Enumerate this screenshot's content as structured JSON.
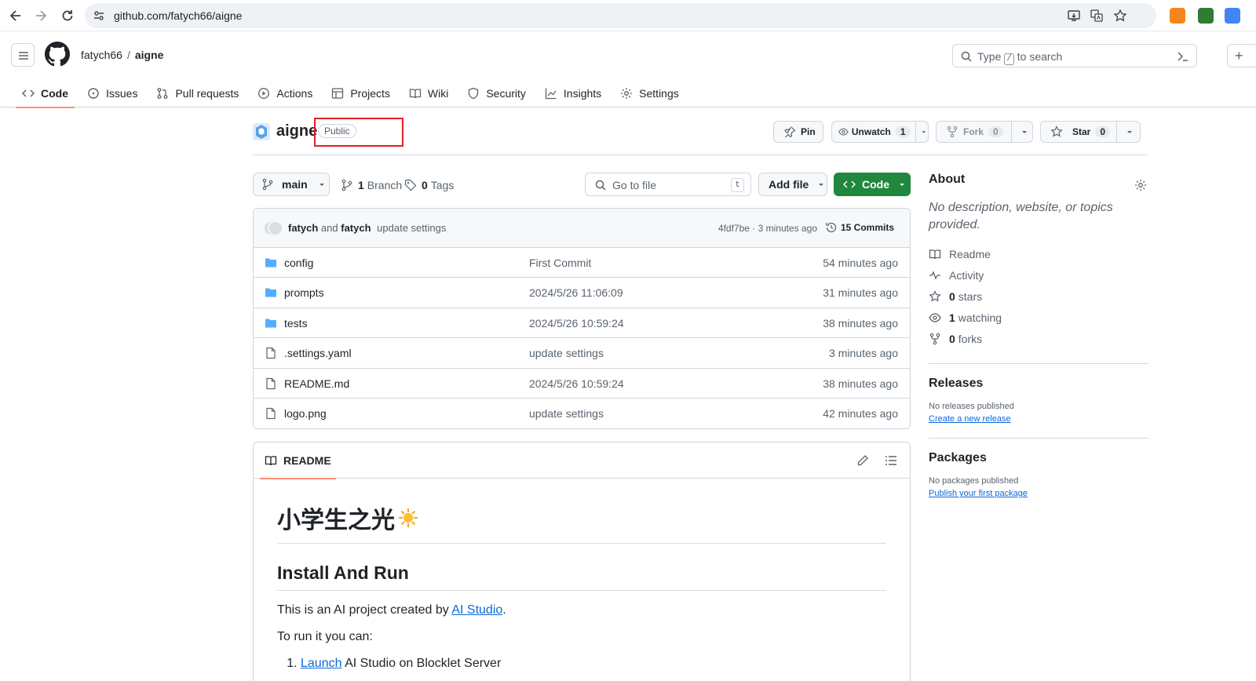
{
  "browser": {
    "url": "github.com/fatych66/aigne"
  },
  "header": {
    "owner": "fatych66",
    "separator": "/",
    "repo": "aigne",
    "search_prefix": "Type",
    "search_key": "/",
    "search_suffix": "to search",
    "plus": "+"
  },
  "tabs": [
    {
      "label": "Code",
      "icon": "code-icon",
      "active": true
    },
    {
      "label": "Issues",
      "icon": "issue-icon"
    },
    {
      "label": "Pull requests",
      "icon": "pull-request-icon"
    },
    {
      "label": "Actions",
      "icon": "play-icon"
    },
    {
      "label": "Projects",
      "icon": "table-icon"
    },
    {
      "label": "Wiki",
      "icon": "book-icon"
    },
    {
      "label": "Security",
      "icon": "shield-icon"
    },
    {
      "label": "Insights",
      "icon": "graph-icon"
    },
    {
      "label": "Settings",
      "icon": "gear-icon"
    }
  ],
  "repo": {
    "name": "aigne",
    "visibility": "Public",
    "pin": "Pin",
    "unwatch": "Unwatch",
    "watch_count": "1",
    "fork": "Fork",
    "fork_count": "0",
    "star": "Star",
    "star_count": "0"
  },
  "toolbar": {
    "branch": "main",
    "branches_count": "1",
    "branches_label": "Branch",
    "tags_count": "0",
    "tags_label": "Tags",
    "go_to_file": "Go to file",
    "go_to_file_key": "t",
    "add_file": "Add file",
    "code": "Code"
  },
  "commit": {
    "author1": "fatych",
    "and": "and",
    "author2": "fatych",
    "message": "update settings",
    "sha_time": "4fdf7be · 3 minutes ago",
    "commits": "15 Commits"
  },
  "files": [
    {
      "name": "config",
      "type": "dir",
      "message": "First Commit",
      "age": "54 minutes ago"
    },
    {
      "name": "prompts",
      "type": "dir",
      "message": "2024/5/26 11:06:09",
      "age": "31 minutes ago"
    },
    {
      "name": "tests",
      "type": "dir",
      "message": "2024/5/26 10:59:24",
      "age": "38 minutes ago"
    },
    {
      "name": ".settings.yaml",
      "type": "file",
      "message": "update settings",
      "age": "3 minutes ago"
    },
    {
      "name": "README.md",
      "type": "file",
      "message": "2024/5/26 10:59:24",
      "age": "38 minutes ago"
    },
    {
      "name": "logo.png",
      "type": "file",
      "message": "update settings",
      "age": "42 minutes ago"
    }
  ],
  "readme": {
    "tab": "README",
    "h1": "小学生之光",
    "h2": "Install And Run",
    "p1_prefix": "This is an AI project created by ",
    "p1_link": "AI Studio",
    "p1_suffix": ".",
    "p2": "To run it you can:",
    "li1_link": "Launch",
    "li1_text": " AI Studio on Blocklet Server"
  },
  "about": {
    "title": "About",
    "description": "No description, website, or topics provided.",
    "readme": "Readme",
    "activity": "Activity",
    "stars_count": "0",
    "stars": "stars",
    "watching_count": "1",
    "watching": "watching",
    "forks_count": "0",
    "forks": "forks"
  },
  "releases": {
    "title": "Releases",
    "empty": "No releases published",
    "link": "Create a new release"
  },
  "packages": {
    "title": "Packages",
    "empty": "No packages published",
    "link": "Publish your first package"
  },
  "colors": {
    "accent_green": "#1f883d",
    "tab_underline": "#fd8c73",
    "link_blue": "#0969da",
    "highlight_red": "#e11d2a"
  }
}
